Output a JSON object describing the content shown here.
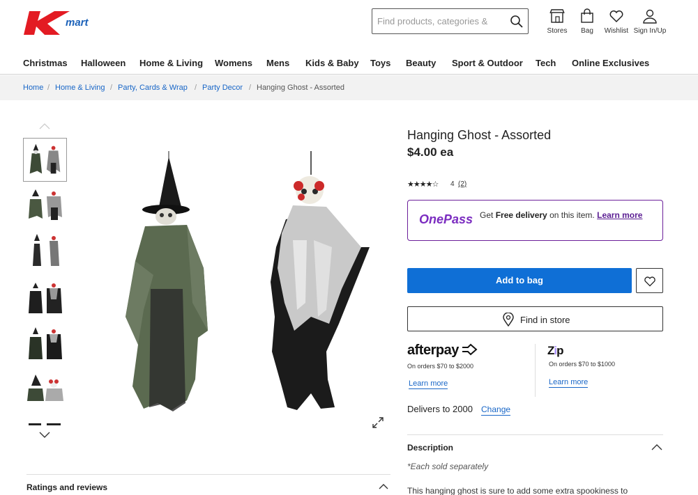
{
  "brand": {
    "name": "Kmart",
    "accent": "#e31b23",
    "blue": "#1c62b9"
  },
  "header": {
    "search_placeholder": "Find products, categories &",
    "icons": [
      {
        "name": "store-icon",
        "label": "Stores"
      },
      {
        "name": "bag-icon",
        "label": "Bag"
      },
      {
        "name": "heart-icon",
        "label": "Wishlist"
      },
      {
        "name": "user-icon",
        "label": "Sign In/Up"
      }
    ]
  },
  "nav": {
    "items": [
      "Christmas",
      "Halloween",
      "Home & Living",
      "Womens",
      "Mens",
      "Kids & Baby",
      "Toys",
      "Beauty",
      "Sport & Outdoor",
      "Tech",
      "Online Exclusives"
    ]
  },
  "breadcrumb": {
    "items": [
      "Home",
      "Home & Living",
      "Party, Cards & Wrap",
      "Party Decor"
    ],
    "current": "Hanging Ghost - Assorted",
    "separator": "/"
  },
  "product": {
    "title": "Hanging Ghost - Assorted",
    "price": "$4.00 ea",
    "stars": "★★★★☆",
    "rating": "4",
    "review_count": "(2)"
  },
  "onepass": {
    "logo": "OnePass",
    "text_pre": "Get ",
    "text_bold": "Free delivery",
    "text_post": " on this item.",
    "learn": "Learn more",
    "color": "#7b2cc0"
  },
  "actions": {
    "add_to_bag": "Add to bag",
    "find_in_store": "Find in store",
    "button_color": "#0f6fd6"
  },
  "payments": {
    "afterpay": {
      "logo": "afterpay",
      "sub": "On orders $70 to $2000",
      "learn": "Learn more"
    },
    "zip": {
      "logo_a": "Z",
      "logo_b": "i",
      "logo_c": "p",
      "sub": "On orders $70 to $1000",
      "learn": "Learn more"
    }
  },
  "delivery": {
    "text": "Delivers to 2000",
    "change": "Change"
  },
  "description": {
    "title": "Description",
    "note": "*Each sold separately",
    "body": "This hanging ghost is sure to add some extra spookiness to"
  },
  "ratings_section": {
    "title": "Ratings and reviews"
  }
}
